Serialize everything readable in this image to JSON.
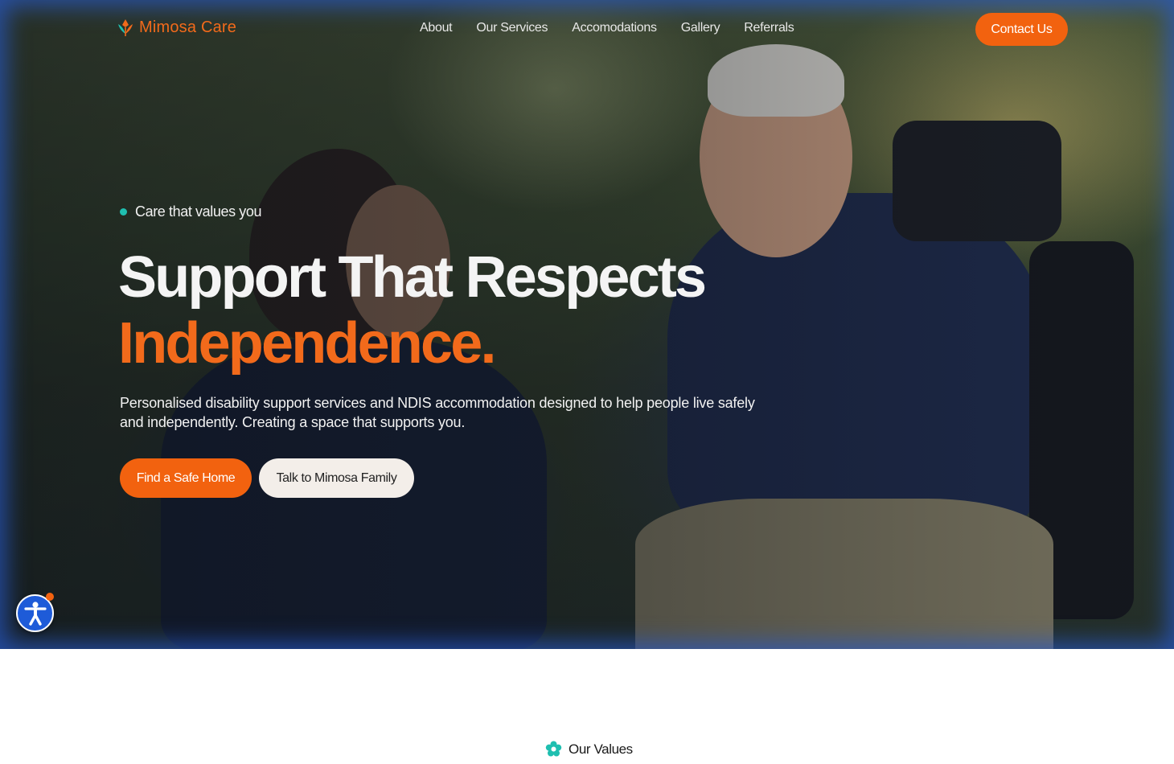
{
  "brand": {
    "name": "Mimosa Care",
    "accent": "#f26a1b",
    "teal": "#1fbfb0"
  },
  "nav": {
    "items": [
      {
        "label": "About"
      },
      {
        "label": "Our Services"
      },
      {
        "label": "Accomodations"
      },
      {
        "label": "Gallery"
      },
      {
        "label": "Referrals"
      }
    ],
    "contact_label": "Contact Us"
  },
  "hero": {
    "eyebrow": "Care that values you",
    "headline_line1": "Support That Respects",
    "headline_line2": "Independence.",
    "subcopy": "Personalised disability support services and NDIS accommodation designed to help people live safely and independently.  Creating a space that supports you.",
    "primary_cta": "Find a Safe Home",
    "secondary_cta": "Talk to Mimosa Family"
  },
  "accessibility": {
    "icon": "accessibility-icon"
  },
  "values": {
    "label": "Our Values",
    "icon": "flower-icon"
  }
}
